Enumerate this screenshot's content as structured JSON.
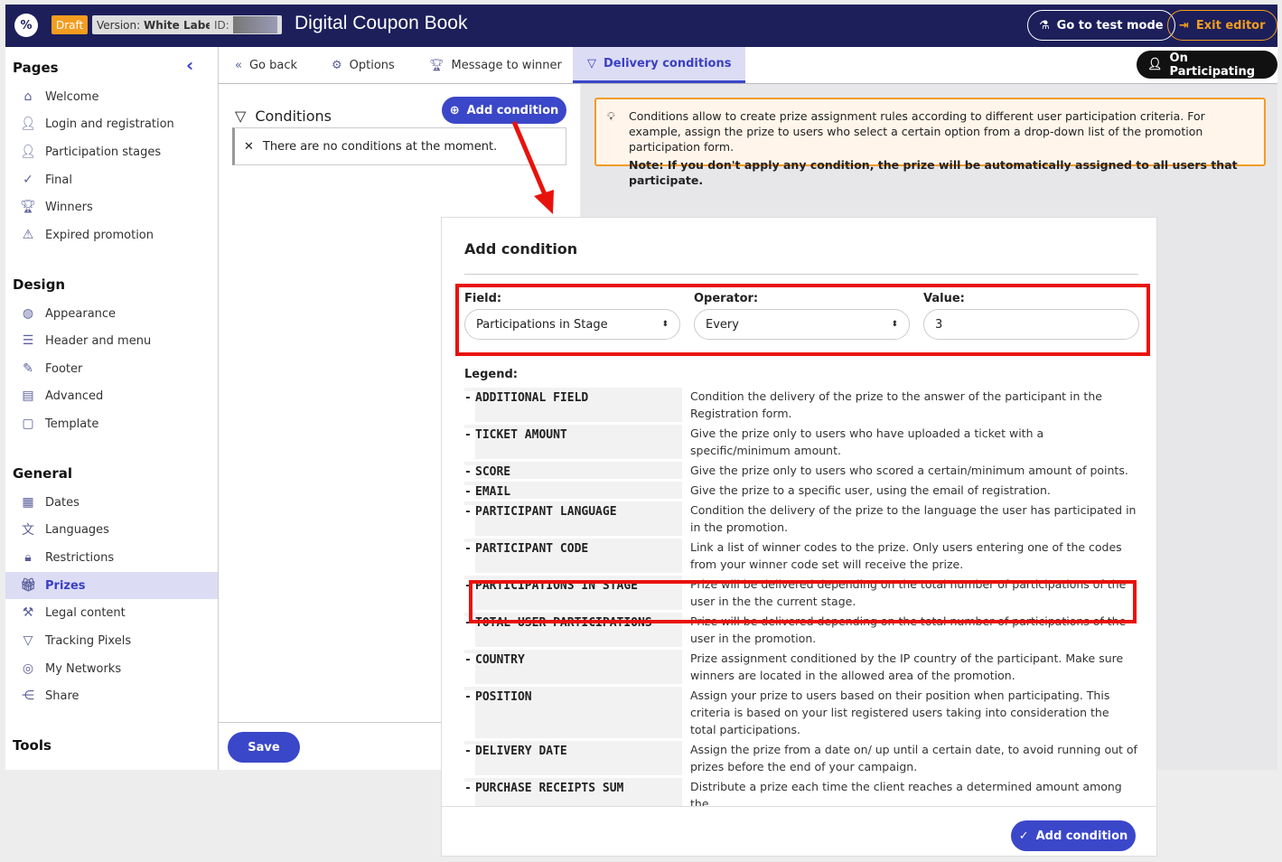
{
  "header": {
    "status": "Draft",
    "version_label": "Version:",
    "version": "White Label",
    "id_label": "ID:",
    "title": "Digital Coupon Book",
    "test_mode": "Go to test mode",
    "exit": "Exit editor"
  },
  "sidebar": {
    "collapse_icon": "chevron-left-icon",
    "sections": [
      {
        "title": "Pages",
        "items": [
          {
            "label": "Welcome",
            "icon": "home-icon"
          },
          {
            "label": "Login and registration",
            "icon": "user-icon"
          },
          {
            "label": "Participation stages",
            "icon": "user-icon"
          },
          {
            "label": "Final",
            "icon": "check-icon"
          },
          {
            "label": "Winners",
            "icon": "trophy-icon"
          },
          {
            "label": "Expired promotion",
            "icon": "warning-icon"
          }
        ]
      },
      {
        "title": "Design",
        "items": [
          {
            "label": "Appearance",
            "icon": "palette-icon"
          },
          {
            "label": "Header and menu",
            "icon": "menu-icon"
          },
          {
            "label": "Footer",
            "icon": "footer-icon"
          },
          {
            "label": "Advanced",
            "icon": "code-icon"
          },
          {
            "label": "Template",
            "icon": "file-icon"
          }
        ]
      },
      {
        "title": "General",
        "items": [
          {
            "label": "Dates",
            "icon": "calendar-icon"
          },
          {
            "label": "Languages",
            "icon": "translate-icon"
          },
          {
            "label": "Restrictions",
            "icon": "lock-icon"
          },
          {
            "label": "Prizes",
            "icon": "gift-icon",
            "active": true
          },
          {
            "label": "Legal content",
            "icon": "gavel-icon"
          },
          {
            "label": "Tracking Pixels",
            "icon": "filter-icon"
          },
          {
            "label": "My Networks",
            "icon": "globe-icon"
          },
          {
            "label": "Share",
            "icon": "share-icon"
          }
        ]
      },
      {
        "title": "Tools",
        "items": []
      }
    ]
  },
  "toolbar": {
    "go_back": "Go back",
    "options": "Options",
    "message": "Message to winner",
    "delivery": "Delivery conditions",
    "on_participating": "On Participating"
  },
  "conditions": {
    "title": "Conditions",
    "add": "Add condition",
    "empty": "There are no conditions at the moment.",
    "save": "Save"
  },
  "notice": {
    "text": "Conditions allow to create prize assignment rules according to different user participation criteria. For example, assign the prize to users who select a certain option from a drop-down list of the promotion participation form.",
    "note": "Note: If you don't apply any condition, the prize will be automatically assigned to all users that participate."
  },
  "modal": {
    "title": "Add condition",
    "field_label": "Field:",
    "field_value": "Participations in Stage",
    "operator_label": "Operator:",
    "operator_value": "Every",
    "value_label": "Value:",
    "value": "3",
    "legend_label": "Legend:",
    "submit": "Add condition",
    "legend": [
      {
        "term": "ADDITIONAL FIELD",
        "desc": "Condition the delivery of the prize to the answer of the participant in the Registration form."
      },
      {
        "term": "TICKET AMOUNT",
        "desc": "Give the prize only to users who have uploaded a ticket with a specific/minimum amount."
      },
      {
        "term": "SCORE",
        "desc": "Give the prize only to users who scored a certain/minimum amount of points."
      },
      {
        "term": "EMAIL",
        "desc": "Give the prize to a specific user, using the email of registration."
      },
      {
        "term": "PARTICIPANT LANGUAGE",
        "desc": "Condition the delivery of the prize to the language the user has participated in in the promotion."
      },
      {
        "term": "PARTICIPANT CODE",
        "desc": "Link a list of winner codes to the prize. Only users entering one of the codes from your winner code set will receive the prize."
      },
      {
        "term": "PARTICIPATIONS IN STAGE",
        "desc": "Prize will be delivered depending on the total number of participations of the user in the the current stage."
      },
      {
        "term": "TOTAL USER PARTICIPATIONS",
        "desc": "Prize will be delivered depending on the total number of participations of the user in the promotion."
      },
      {
        "term": "COUNTRY",
        "desc": "Prize assignment conditioned by the IP country of the participant. Make sure winners are located in the allowed area of the promotion."
      },
      {
        "term": "POSITION",
        "desc": "Assign your prize to users based on their position when participating. This criteria is based on your list registered users taking into consideration the total participations."
      },
      {
        "term": "DELIVERY DATE",
        "desc": "Assign the prize from a date on/ up until a certain date, to avoid running out of prizes before the end of your campaign."
      },
      {
        "term": "PURCHASE RECEIPTS SUM",
        "desc": "Distribute a prize each time the client reaches a determined amount among the"
      }
    ]
  },
  "colors": {
    "navy": "#1c1f5a",
    "accent": "#3b47c9",
    "draft": "#f39c1f",
    "highlight": "#e8120c"
  }
}
